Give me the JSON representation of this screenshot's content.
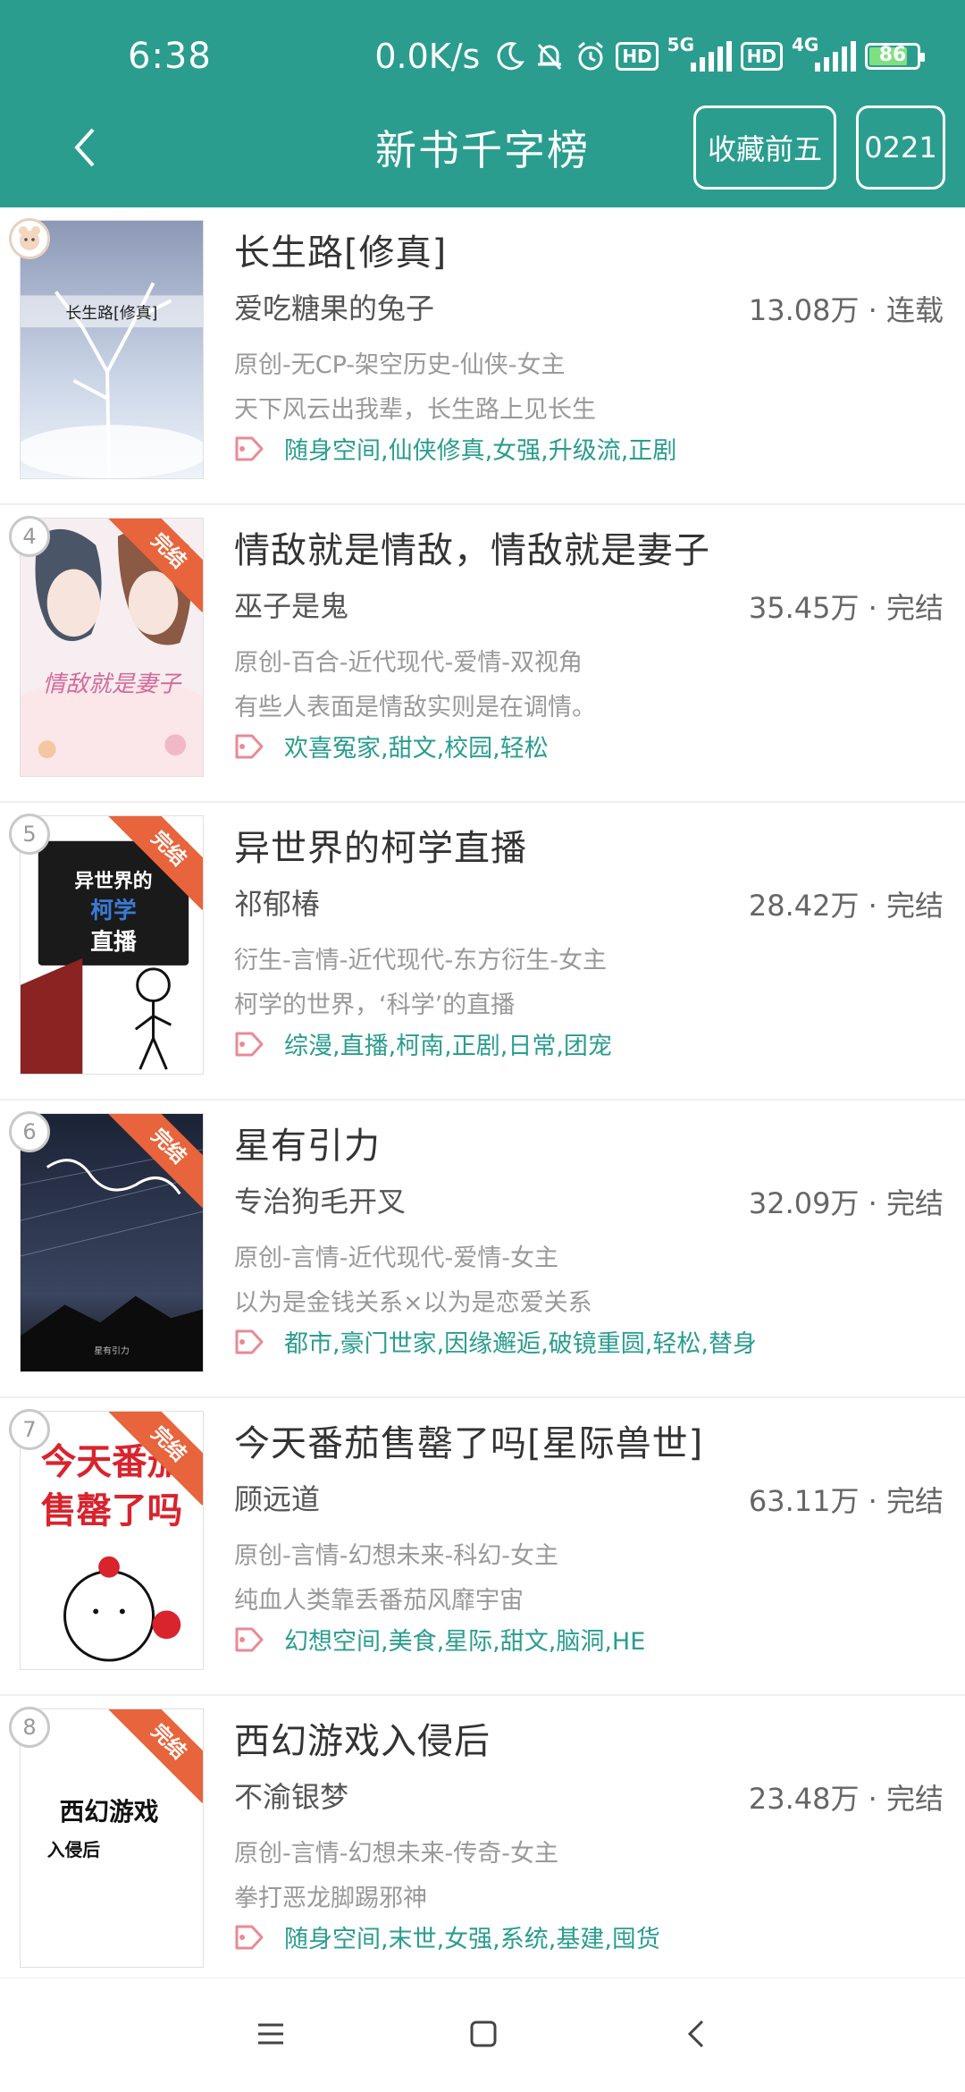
{
  "status": {
    "time": "6:38",
    "net_speed": "0.0K/s",
    "sim1": "5G",
    "sim2": "4G",
    "hd": "HD",
    "battery": "86"
  },
  "header": {
    "title": "新书千字榜",
    "fav_button": "收藏前五",
    "date_button": "0221"
  },
  "colors": {
    "accent": "#2a9d8f",
    "ribbon": "#e8643c",
    "tag": "#2a9d8f"
  },
  "books": [
    {
      "rank": "",
      "ribbon": "",
      "cover_text": "长生路[修真]",
      "title": "长生路[修真]",
      "author": "爱吃糖果的兔子",
      "count": "13.08万 · 连载",
      "genre": "原创-无CP-架空历史-仙侠-女主",
      "desc": "天下风云出我辈，长生路上见长生",
      "tags": "随身空间,仙侠修真,女强,升级流,正剧"
    },
    {
      "rank": "4",
      "ribbon": "完结",
      "cover_text": "情敌就是妻子",
      "title": "情敌就是情敌，情敌就是妻子",
      "author": "巫子是鬼",
      "count": "35.45万 · 完结",
      "genre": "原创-百合-近代现代-爱情-双视角",
      "desc": "有些人表面是情敌实则是在调情。",
      "tags": "欢喜冤家,甜文,校园,轻松"
    },
    {
      "rank": "5",
      "ribbon": "完结",
      "cover_text": "异世界的柯学直播",
      "title": "异世界的柯学直播",
      "author": "祁郁椿",
      "count": "28.42万 · 完结",
      "genre": "衍生-言情-近代现代-东方衍生-女主",
      "desc": "柯学的世界，‘科学’的直播",
      "tags": "综漫,直播,柯南,正剧,日常,团宠"
    },
    {
      "rank": "6",
      "ribbon": "完结",
      "cover_text": "星有引力",
      "title": "星有引力",
      "author": "专治狗毛开叉",
      "count": "32.09万 · 完结",
      "genre": "原创-言情-近代现代-爱情-女主",
      "desc": "以为是金钱关系×以为是恋爱关系",
      "tags": "都市,豪门世家,因缘邂逅,破镜重圆,轻松,替身"
    },
    {
      "rank": "7",
      "ribbon": "完结",
      "cover_text": "今天番茄售罄了吗",
      "title": "今天番茄售罄了吗[星际兽世]",
      "author": "顾远道",
      "count": "63.11万 · 完结",
      "genre": "原创-言情-幻想未来-科幻-女主",
      "desc": "纯血人类靠丢番茄风靡宇宙",
      "tags": "幻想空间,美食,星际,甜文,脑洞,HE"
    },
    {
      "rank": "8",
      "ribbon": "完结",
      "cover_text": "西幻游戏入侵后",
      "title": "西幻游戏入侵后",
      "author": "不渝银梦",
      "count": "23.48万 · 完结",
      "genre": "原创-言情-幻想未来-传奇-女主",
      "desc": "拳打恶龙脚踢邪神",
      "tags": "随身空间,末世,女强,系统,基建,囤货"
    }
  ]
}
